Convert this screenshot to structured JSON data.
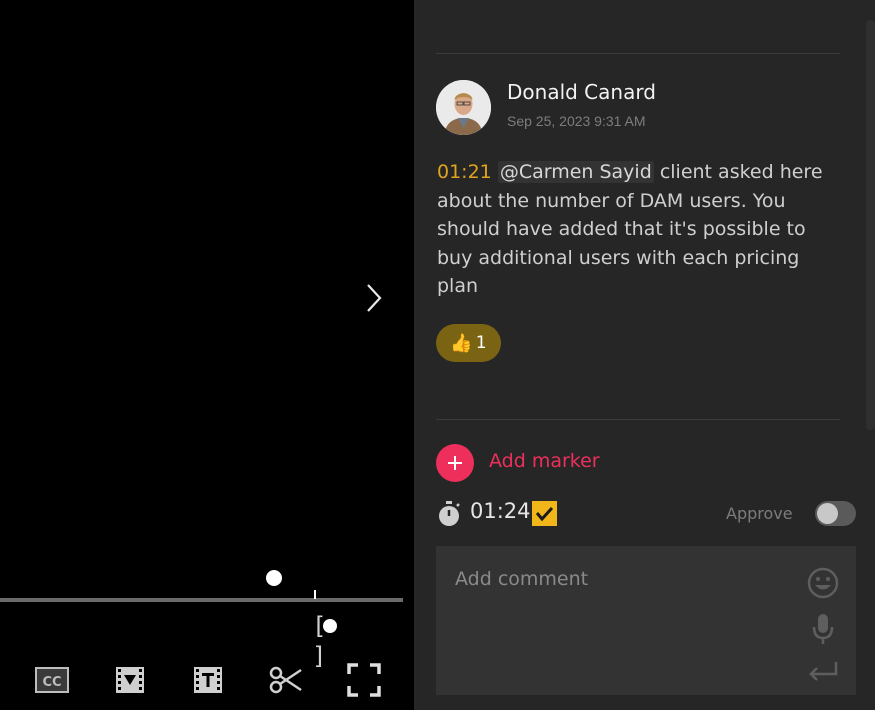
{
  "player": {
    "next_icon": "chevron-right-icon",
    "controls": [
      {
        "name": "closed-captions-button",
        "icon": "cc-icon",
        "text": "CC"
      },
      {
        "name": "video-marker-button",
        "icon": "video-marker-icon"
      },
      {
        "name": "text-marker-button",
        "icon": "text-marker-icon"
      },
      {
        "name": "trim-button",
        "icon": "scissors-icon"
      },
      {
        "name": "fullscreen-button",
        "icon": "fullscreen-icon"
      }
    ]
  },
  "comment": {
    "author": "Donald Canard",
    "timestamp": "Sep 25, 2023 9:31 AM",
    "time_code": "01:21",
    "mention": "@Carmen Sayid",
    "text": " client asked here about the number of DAM users. You should have added that it's possible to buy additional users with each pricing plan",
    "reaction": {
      "emoji": "👍",
      "count": "1"
    }
  },
  "composer": {
    "add_marker_label": "Add marker",
    "time_code": "01:24",
    "approve_label": "Approve",
    "approve_on": false,
    "placeholder": "Add comment"
  },
  "colors": {
    "accent_pink": "#ee2f5c",
    "time_gold": "#e0a51c",
    "check_yellow": "#f1b71a",
    "reaction_bg": "#7b6314"
  }
}
